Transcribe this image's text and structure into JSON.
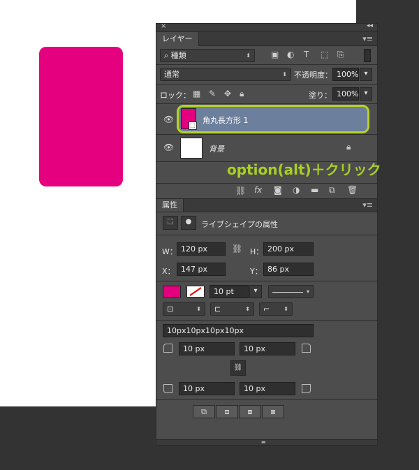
{
  "layers_panel": {
    "tab": "レイヤー",
    "filter_kind": "種類",
    "blend_mode": "通常",
    "opacity_label": "不透明度：",
    "opacity_value": "100%",
    "lock_label": "ロック：",
    "fill_label": "塗り：",
    "fill_value": "100%",
    "layers": [
      {
        "name": "角丸長方形 1",
        "selected": true
      },
      {
        "name": "背景",
        "selected": false
      }
    ]
  },
  "annotation": {
    "text": "option(alt)＋クリック",
    "color": "#a9d022"
  },
  "properties_panel": {
    "tab": "属性",
    "title": "ライブシェイプの属性",
    "w_label": "W：",
    "w_value": "120 px",
    "h_label": "H：",
    "h_value": "200 px",
    "x_label": "X：",
    "x_value": "147 px",
    "y_label": "Y：",
    "y_value": "86 px",
    "stroke_width": "10 pt",
    "corner_radii_text": "10px10px10px10px",
    "radius_tl": "10 px",
    "radius_tr": "10 px",
    "radius_bl": "10 px",
    "radius_br": "10 px"
  },
  "colors": {
    "shape_fill": "#e4007f",
    "highlight": "#b4d228"
  }
}
